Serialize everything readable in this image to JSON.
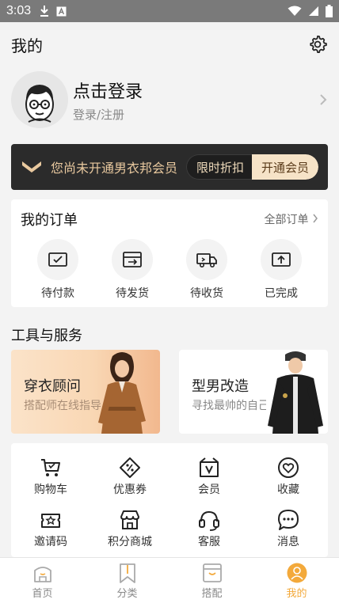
{
  "status_bar": {
    "time": "3:03"
  },
  "header": {
    "title": "我的"
  },
  "profile": {
    "login_label": "点击登录",
    "sub_label": "登录/注册"
  },
  "vip": {
    "message": "您尚未开通男衣邦会员",
    "tag_limited": "限时折扣",
    "tag_open": "开通会员",
    "accent": "#e9c99f"
  },
  "orders": {
    "title": "我的订单",
    "all_label": "全部订单",
    "items": [
      {
        "label": "待付款",
        "icon": "wallet-icon"
      },
      {
        "label": "待发货",
        "icon": "package-icon"
      },
      {
        "label": "待收货",
        "icon": "truck-icon"
      },
      {
        "label": "已完成",
        "icon": "upload-box-icon"
      }
    ]
  },
  "tools": {
    "title": "工具与服务",
    "banners": [
      {
        "title": "穿衣顾问",
        "subtitle": "搭配师在线指导"
      },
      {
        "title": "型男改造",
        "subtitle": "寻找最帅的自己"
      }
    ],
    "items": [
      {
        "label": "购物车",
        "icon": "cart-icon"
      },
      {
        "label": "优惠券",
        "icon": "coupon-icon"
      },
      {
        "label": "会员",
        "icon": "vip-icon"
      },
      {
        "label": "收藏",
        "icon": "heart-icon"
      },
      {
        "label": "邀请码",
        "icon": "ticket-icon"
      },
      {
        "label": "积分商城",
        "icon": "store-icon"
      },
      {
        "label": "客服",
        "icon": "headset-icon"
      },
      {
        "label": "消息",
        "icon": "message-icon"
      }
    ]
  },
  "tabbar": {
    "active_color": "#f3a93b",
    "tabs": [
      {
        "label": "首页",
        "icon": "home-icon"
      },
      {
        "label": "分类",
        "icon": "bookmark-icon"
      },
      {
        "label": "搭配",
        "icon": "box-icon"
      },
      {
        "label": "我的",
        "icon": "user-icon"
      }
    ]
  }
}
